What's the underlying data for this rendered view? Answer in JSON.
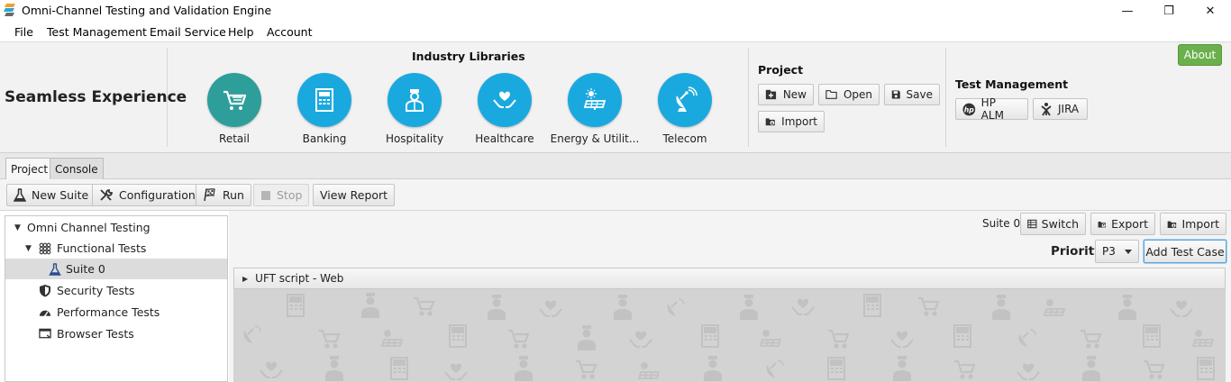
{
  "window": {
    "title": "Omni-Channel Testing and Validation Engine",
    "controls": {
      "minimize": "—",
      "maximize": "❐",
      "close": "✕"
    }
  },
  "menu": {
    "items": [
      "File",
      "Test Management",
      "Email Service",
      "Help",
      "Account"
    ]
  },
  "ribbon": {
    "brand": "Seamless Experience",
    "libraries_title": "Industry Libraries",
    "libraries": [
      {
        "label": "Retail",
        "icon": "shopping-cart-icon",
        "color": "#2e9e9a"
      },
      {
        "label": "Banking",
        "icon": "atm-icon",
        "color": "#1aa9df"
      },
      {
        "label": "Hospitality",
        "icon": "bellhop-icon",
        "color": "#1aa9df"
      },
      {
        "label": "Healthcare",
        "icon": "heart-hands-icon",
        "color": "#1aa9df"
      },
      {
        "label": "Energy & Utilit...",
        "icon": "solar-panel-icon",
        "color": "#1aa9df"
      },
      {
        "label": "Telecom",
        "icon": "satellite-dish-icon",
        "color": "#1aa9df"
      }
    ],
    "project_title": "Project",
    "project_buttons": {
      "new": "New",
      "open": "Open",
      "save": "Save",
      "import": "Import"
    },
    "tm_title": "Test Management",
    "tm_buttons": {
      "hpalm": "HP ALM",
      "jira": "JIRA"
    },
    "about": "About",
    "about_color": "#6ab04c"
  },
  "tabs": [
    "Project",
    "Console"
  ],
  "toolbar": {
    "new_suite": "New Suite",
    "configuration": "Configuration",
    "run": "Run",
    "stop": "Stop",
    "view_report": "View Report"
  },
  "tree": {
    "root": "Omni Channel Testing",
    "functional": "Functional Tests",
    "suite": "Suite 0",
    "security": "Security Tests",
    "performance": "Performance Tests",
    "browser": "Browser Tests"
  },
  "panel": {
    "suite_label": "Suite 0",
    "switch": "Switch",
    "export": "Export",
    "import": "Import",
    "priority_label": "Priority",
    "priority_value": "P3",
    "add_test_case": "Add Test Case",
    "accordion_title": "UFT script - Web"
  }
}
